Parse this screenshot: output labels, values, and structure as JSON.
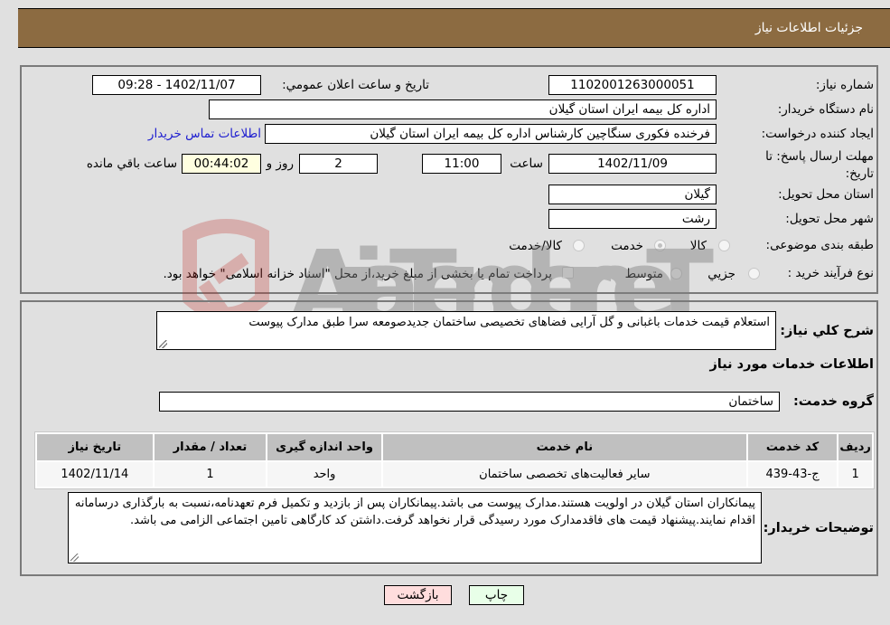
{
  "header": {
    "title": "جزئیات اطلاعات نیاز"
  },
  "form": {
    "need_number": {
      "label": "شماره نیاز:",
      "value": "1102001263000051"
    },
    "announce_datetime": {
      "label": "تاریخ و ساعت اعلان عمومي:",
      "value": "1402/11/07 - 09:28"
    },
    "buyer_org": {
      "label": "نام دستگاه خريدار:",
      "value": "اداره کل بیمه ایران استان گیلان"
    },
    "requester": {
      "label": "ایجاد کننده درخواست:",
      "value": "فرخنده فکوری سنگاچین کارشناس اداره کل بیمه ایران استان گیلان"
    },
    "buyer_contact_link": "اطلاعات تماس خريدار",
    "deadline": {
      "label": "مهلت ارسال پاسخ: تا تاریخ:",
      "date": "1402/11/09",
      "time_label": "ساعت",
      "time": "11:00",
      "days": "2",
      "days_label": "روز و",
      "remaining": "00:44:02",
      "remaining_label": "ساعت باقي مانده"
    },
    "province": {
      "label": "استان محل تحویل:",
      "value": "گیلان"
    },
    "city": {
      "label": "شهر محل تحویل:",
      "value": "رشت"
    },
    "category": {
      "label": "طبقه بندی موضوعی:",
      "options": [
        "کالا",
        "خدمت",
        "کالا/خدمت"
      ],
      "selected": "خدمت"
    },
    "purchase_type": {
      "label": "نوع فرآیند خرید :",
      "options": [
        "جزيي",
        "متوسط"
      ],
      "treasury_note": "پرداخت تمام یا بخشی از مبلغ خرید،از محل \"اسناد خزانه اسلامی\" خواهد بود."
    }
  },
  "details": {
    "description_label": "شرح کلي نياز:",
    "description": "استعلام قیمت خدمات باغبانی و گل آرایی فضاهای تخصیصی ساختمان جدیدصومعه سرا طبق مدارک پیوست",
    "services_heading": "اطلاعات خدمات مورد نياز",
    "service_group_label": "گروه خدمت:",
    "service_group": "ساختمان",
    "table": {
      "headers": [
        "رديف",
        "کد خدمت",
        "نام خدمت",
        "واحد اندازه گيری",
        "تعداد / مقدار",
        "تاريخ نياز"
      ],
      "rows": [
        [
          "1",
          "ج-43-439",
          "سایر فعالیت‌های تخصصی ساختمان",
          "واحد",
          "1",
          "1402/11/14"
        ]
      ]
    },
    "buyer_notes_label": "توضیحات خریدار:",
    "buyer_notes": "پیمانکاران استان گیلان در اولویت هستند.مدارک پیوست می باشد.پیمانکاران پس از بازدید و تکمیل فرم تعهدنامه،نسبت به بارگذاری درسامانه اقدام نمایند.پیشنهاد قیمت های فاقدمدارک مورد رسیدگی قرار نخواهد گرفت.داشتن کد کارگاهی تامین اجتماعی الزامی می باشد."
  },
  "buttons": {
    "print": "چاپ",
    "back": "بازگشت"
  },
  "watermark": "AriaTender.neT"
}
